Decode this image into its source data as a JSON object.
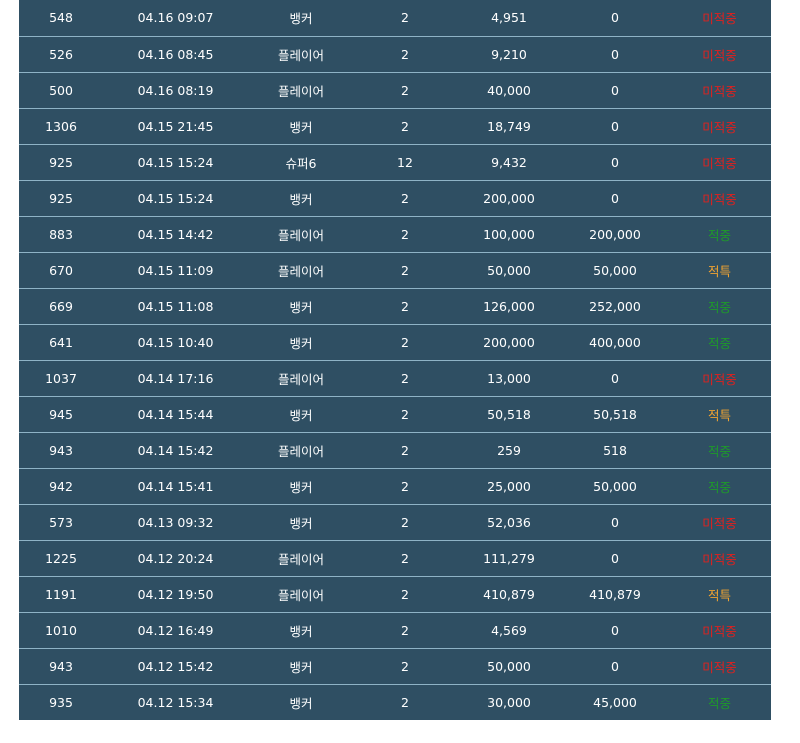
{
  "table": {
    "rows": [
      {
        "id": "548",
        "time": "04.16 09:07",
        "bet": "뱅커",
        "game": "2",
        "amount": "4,951",
        "payout": "0",
        "status": "미적중",
        "status_type": "lost"
      },
      {
        "id": "526",
        "time": "04.16 08:45",
        "bet": "플레이어",
        "game": "2",
        "amount": "9,210",
        "payout": "0",
        "status": "미적중",
        "status_type": "lost"
      },
      {
        "id": "500",
        "time": "04.16 08:19",
        "bet": "플레이어",
        "game": "2",
        "amount": "40,000",
        "payout": "0",
        "status": "미적중",
        "status_type": "lost"
      },
      {
        "id": "1306",
        "time": "04.15 21:45",
        "bet": "뱅커",
        "game": "2",
        "amount": "18,749",
        "payout": "0",
        "status": "미적중",
        "status_type": "lost"
      },
      {
        "id": "925",
        "time": "04.15 15:24",
        "bet": "슈퍼6",
        "game": "12",
        "amount": "9,432",
        "payout": "0",
        "status": "미적중",
        "status_type": "lost"
      },
      {
        "id": "925",
        "time": "04.15 15:24",
        "bet": "뱅커",
        "game": "2",
        "amount": "200,000",
        "payout": "0",
        "status": "미적중",
        "status_type": "lost"
      },
      {
        "id": "883",
        "time": "04.15 14:42",
        "bet": "플레이어",
        "game": "2",
        "amount": "100,000",
        "payout": "200,000",
        "status": "적중",
        "status_type": "win"
      },
      {
        "id": "670",
        "time": "04.15 11:09",
        "bet": "플레이어",
        "game": "2",
        "amount": "50,000",
        "payout": "50,000",
        "status": "적특",
        "status_type": "tie"
      },
      {
        "id": "669",
        "time": "04.15 11:08",
        "bet": "뱅커",
        "game": "2",
        "amount": "126,000",
        "payout": "252,000",
        "status": "적중",
        "status_type": "win"
      },
      {
        "id": "641",
        "time": "04.15 10:40",
        "bet": "뱅커",
        "game": "2",
        "amount": "200,000",
        "payout": "400,000",
        "status": "적중",
        "status_type": "win"
      },
      {
        "id": "1037",
        "time": "04.14 17:16",
        "bet": "플레이어",
        "game": "2",
        "amount": "13,000",
        "payout": "0",
        "status": "미적중",
        "status_type": "lost"
      },
      {
        "id": "945",
        "time": "04.14 15:44",
        "bet": "뱅커",
        "game": "2",
        "amount": "50,518",
        "payout": "50,518",
        "status": "적특",
        "status_type": "tie"
      },
      {
        "id": "943",
        "time": "04.14 15:42",
        "bet": "플레이어",
        "game": "2",
        "amount": "259",
        "payout": "518",
        "status": "적중",
        "status_type": "win"
      },
      {
        "id": "942",
        "time": "04.14 15:41",
        "bet": "뱅커",
        "game": "2",
        "amount": "25,000",
        "payout": "50,000",
        "status": "적중",
        "status_type": "win"
      },
      {
        "id": "573",
        "time": "04.13 09:32",
        "bet": "뱅커",
        "game": "2",
        "amount": "52,036",
        "payout": "0",
        "status": "미적중",
        "status_type": "lost"
      },
      {
        "id": "1225",
        "time": "04.12 20:24",
        "bet": "플레이어",
        "game": "2",
        "amount": "111,279",
        "payout": "0",
        "status": "미적중",
        "status_type": "lost"
      },
      {
        "id": "1191",
        "time": "04.12 19:50",
        "bet": "플레이어",
        "game": "2",
        "amount": "410,879",
        "payout": "410,879",
        "status": "적특",
        "status_type": "tie"
      },
      {
        "id": "1010",
        "time": "04.12 16:49",
        "bet": "뱅커",
        "game": "2",
        "amount": "4,569",
        "payout": "0",
        "status": "미적중",
        "status_type": "lost"
      },
      {
        "id": "943",
        "time": "04.12 15:42",
        "bet": "뱅커",
        "game": "2",
        "amount": "50,000",
        "payout": "0",
        "status": "미적중",
        "status_type": "lost"
      },
      {
        "id": "935",
        "time": "04.12 15:34",
        "bet": "뱅커",
        "game": "2",
        "amount": "30,000",
        "payout": "45,000",
        "status": "적중",
        "status_type": "win"
      }
    ]
  },
  "colors": {
    "row_background": "#2f4f63",
    "row_divider": "#8fb3c6",
    "text": "#ffffff",
    "status_lost": "#e0211f",
    "status_win": "#1e9a2a",
    "status_tie": "#f0a330"
  }
}
